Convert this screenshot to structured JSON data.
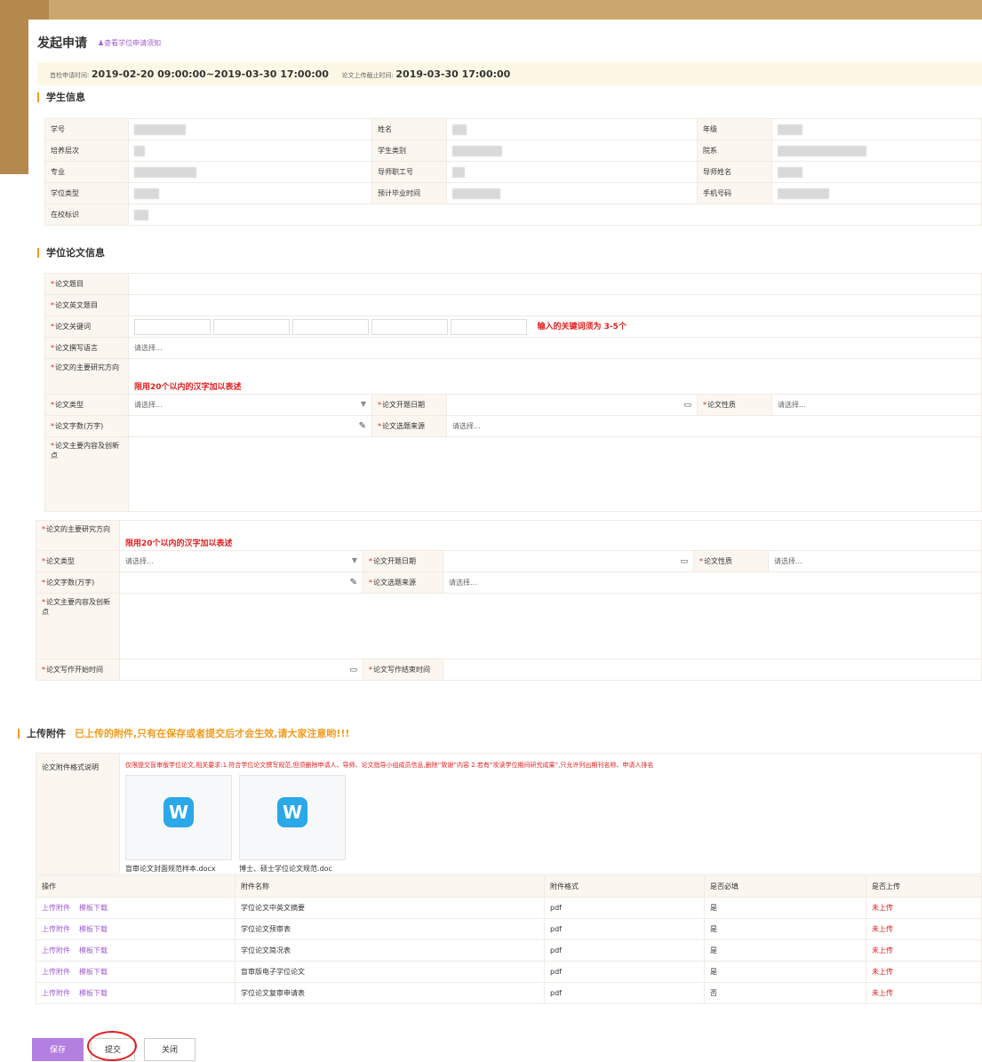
{
  "header": {
    "title": "发起申请",
    "notice_link": "查看学位申请须知",
    "check_time_label": "首检申请时间:",
    "check_time_value": "2019-02-20 09:00:00~2019-03-30 17:00:00",
    "upload_deadline_label": "论文上传截止时间:",
    "upload_deadline_value": "2019-03-30 17:00:00"
  },
  "student": {
    "section_title": "学生信息",
    "labels": [
      "学号",
      "姓名",
      "年级",
      "培养层次",
      "学生类别",
      "院系",
      "专业",
      "导师职工号",
      "导师姓名",
      "学位类型",
      "预计毕业时间",
      "手机号码",
      "在校标识"
    ]
  },
  "thesis": {
    "section_title": "学位论文信息",
    "title_label": "论文题目",
    "en_title_label": "论文英文题目",
    "keywords_label": "论文关键词",
    "keywords_hint": "输入的关键词须为 3-5个",
    "language_label": "论文撰写语言",
    "direction_label": "论文的主要研究方向",
    "direction_hint": "限用20个以内的汉字加以表述",
    "type_label": "论文类型",
    "open_date_label": "论文开题日期",
    "nature_label": "论文性质",
    "words_label": "论文字数(万字)",
    "source_label": "论文选题来源",
    "content_label": "论文主要内容及创新点",
    "start_label": "论文写作开始时间",
    "end_label": "论文写作结束时间",
    "placeholder": "请选择..."
  },
  "upload": {
    "section_title": "上传附件",
    "warning": "已上传的附件,只有在保存或者提交后才会生效,请大家注意哟!!!",
    "format_label": "论文附件格式说明",
    "format_desc": "仅限提交盲审版学位论文,相关要求:1.符合学位论文撰写规范,但须删除申请人、导师、论文指导小组成员信息,删除“致谢”内容 2.若有“攻读学位期间研究成果”,只允许列出期刊名称、申请人排名",
    "files": [
      {
        "name": "盲审论文封面规范样本.docx",
        "icon": "word-icon",
        "letter": "W"
      },
      {
        "name": "博士、硕士学位论文规范.doc",
        "icon": "word-icon",
        "letter": "W"
      }
    ],
    "table_headers": [
      "操作",
      "附件名称",
      "附件格式",
      "是否必填",
      "是否上传"
    ],
    "upload_link": "上传附件",
    "template_link": "模板下载",
    "rows": [
      {
        "name": "学位论文中英文摘要",
        "format": "pdf",
        "required": "是",
        "status": "未上传"
      },
      {
        "name": "学位论文预审表",
        "format": "pdf",
        "required": "是",
        "status": "未上传"
      },
      {
        "name": "学位论文简况表",
        "format": "pdf",
        "required": "是",
        "status": "未上传"
      },
      {
        "name": "盲审版电子学位论文",
        "format": "pdf",
        "required": "是",
        "status": "未上传"
      },
      {
        "name": "学位论文复审申请表",
        "format": "pdf",
        "required": "否",
        "status": "未上传"
      }
    ]
  },
  "footer": {
    "save": "保存",
    "submit": "提交",
    "close": "关闭"
  },
  "colors": {
    "accent": "#b37fe0",
    "warn": "#f29c1f",
    "error": "#e02020"
  }
}
